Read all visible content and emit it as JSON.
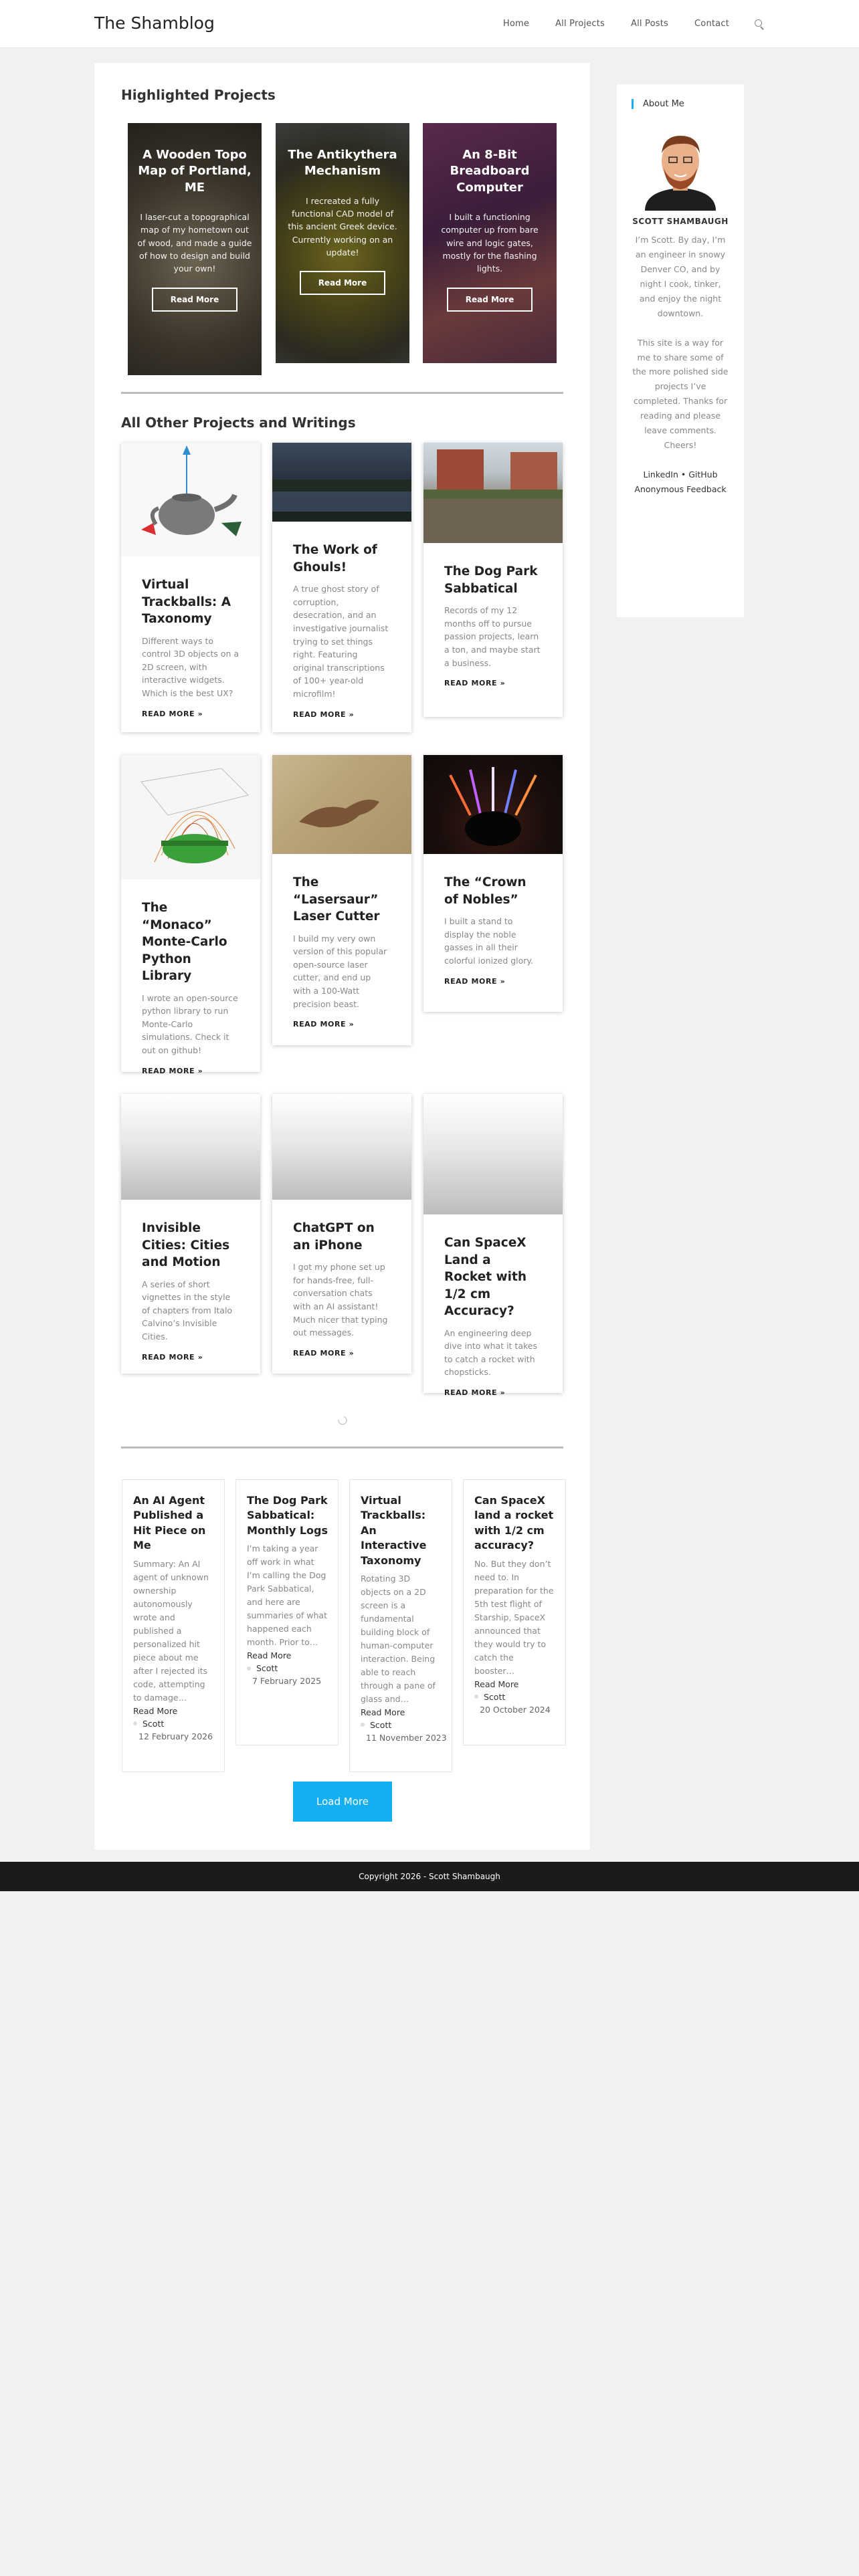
{
  "header": {
    "site_title": "The Shamblog",
    "nav": [
      "Home",
      "All Projects",
      "All Posts",
      "Contact"
    ],
    "search_icon": "search-icon"
  },
  "highlighted": {
    "heading": "Highlighted Projects",
    "cards": [
      {
        "title": "A Wooden Topo Map of Portland, ME",
        "desc": "I laser-cut a topographical map of my hometown out of wood, and made a guide of how to design and build your own!",
        "button": "Read More"
      },
      {
        "title": "The Antikythera Mechanism",
        "desc": "I recreated a fully functional CAD model of this ancient Greek device. Currently working on an update!",
        "button": "Read More"
      },
      {
        "title": "An 8-Bit Breadboard Computer",
        "desc": "I built a functioning computer up from bare wire and logic gates, mostly for the flashing lights.",
        "button": "Read More"
      }
    ]
  },
  "other": {
    "heading": "All Other Projects and Writings",
    "cards": [
      {
        "title": "Virtual Trackballs: A Taxonomy",
        "desc": "Different ways to control 3D objects on a 2D screen, with interactive widgets. Which is the best UX?",
        "more": "READ MORE »"
      },
      {
        "title": "The Work of Ghouls!",
        "desc": "A true ghost story of corruption, desecration, and an investigative journalist trying to set things right. Featuring original transcriptions of 100+ year-old microfilm!",
        "more": "READ MORE »"
      },
      {
        "title": "The Dog Park Sabbatical",
        "desc": "Records of my 12 months off to pursue passion projects, learn a ton, and maybe start a business.",
        "more": "READ MORE »"
      },
      {
        "title": "The “Monaco” Monte-Carlo Python Library",
        "desc": "I wrote an open-source python library to run Monte-Carlo simulations. Check it out on github!",
        "more": "READ MORE »"
      },
      {
        "title": "The “Lasersaur” Laser Cutter",
        "desc": "I build my very own version of this popular open-source laser cutter, and end up with a 100-Watt precision beast.",
        "more": "READ MORE »"
      },
      {
        "title": "The “Crown of Nobles”",
        "desc": "I built a stand to display the noble gasses in all their colorful ionized glory.",
        "more": "READ MORE »"
      },
      {
        "title": "Invisible Cities: Cities and Motion",
        "desc": "A series of short vignettes in the style of chapters from Italo Calvino’s Invisible Cities.",
        "more": "READ MORE »"
      },
      {
        "title": "ChatGPT on an iPhone",
        "desc": "I got my phone set up for hands-free, full-conversation chats with an AI assistant! Much nicer that typing out messages.",
        "more": "READ MORE »"
      },
      {
        "title": "Can SpaceX Land a Rocket with 1/2 cm Accuracy?",
        "desc": "An engineering deep dive into what it takes to catch a rocket with chopsticks.",
        "more": "READ MORE »"
      }
    ]
  },
  "posts": [
    {
      "title": "An AI Agent Published a Hit Piece on Me",
      "summary": "Summary: An AI agent of unknown ownership autonomously wrote and published a personalized hit piece about me after I rejected its code, attempting to damage…",
      "more": "Read More",
      "author": "Scott",
      "date": "12 February 2026"
    },
    {
      "title": "The Dog Park Sabbatical: Monthly Logs",
      "summary": "I’m taking a year off work in what I’m calling the Dog Park Sabbatical, and here are summaries of what happened each month. Prior to…",
      "more": "Read More",
      "author": "Scott",
      "date": "7 February 2025"
    },
    {
      "title": "Virtual Trackballs: An Interactive Taxonomy",
      "summary": "Rotating 3D objects on a 2D screen is a fundamental building block of human-computer interaction. Being able to reach through a pane of glass and…",
      "more": "Read More",
      "author": "Scott",
      "date": "11 November 2023"
    },
    {
      "title": "Can SpaceX land a rocket with 1/2 cm accuracy?",
      "summary": "No. But they don’t need to. In preparation for the 5th test flight of Starship, SpaceX announced that they would try to catch the booster…",
      "more": "Read More",
      "author": "Scott",
      "date": "20 October 2024"
    }
  ],
  "load_more": "Load More",
  "sidebar": {
    "heading": "About Me",
    "name": "SCOTT SHAMBAUGH",
    "bio1": "I’m Scott. By day, I’m an engineer in snowy Denver CO, and by night I cook, tinker, and enjoy the night downtown.",
    "bio2": "This site is a way for me to share some of the more polished side projects I’ve completed. Thanks for reading and please leave comments. Cheers!",
    "links": "LinkedIn • GitHub",
    "anon": "Anonymous Feedback"
  },
  "footer": "Copyright 2026 - Scott Shambaugh",
  "colors": {
    "accent": "#13aff0",
    "footer_bg": "#1b1b1b"
  }
}
